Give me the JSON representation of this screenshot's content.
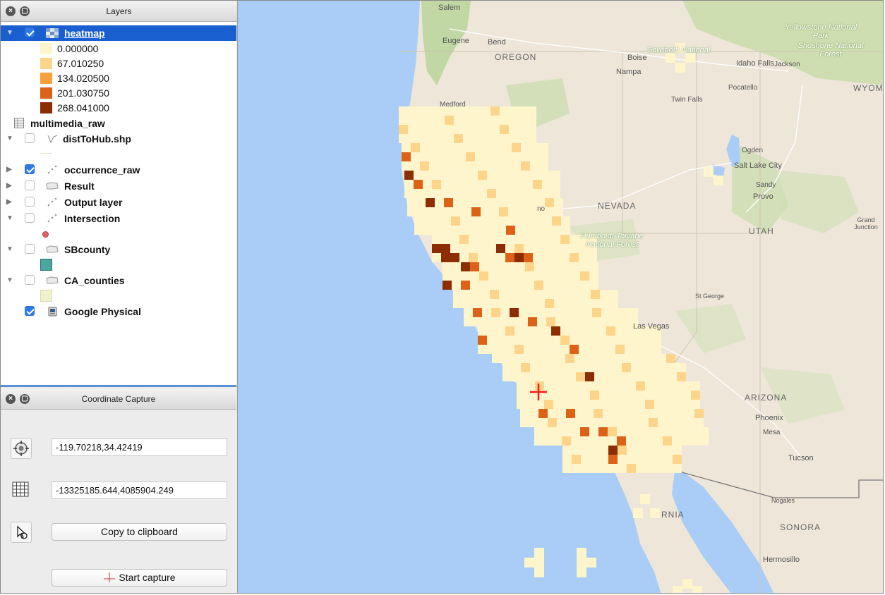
{
  "layers_panel": {
    "title": "Layers",
    "layers": [
      {
        "name": "heatmap",
        "checked": true,
        "expanded": true,
        "selected": true,
        "icon": "raster-heatmap-icon"
      },
      {
        "name": "multimedia_raw",
        "checked": null,
        "icon": "table-icon"
      },
      {
        "name": "distToHub.shp",
        "checked": false,
        "expanded": true,
        "icon": "line-layer-icon"
      },
      {
        "name": "occurrence_raw",
        "checked": true,
        "expanded": false,
        "icon": "point-layer-icon"
      },
      {
        "name": "Result",
        "checked": false,
        "expanded": false,
        "icon": "polygon-layer-icon"
      },
      {
        "name": "Output layer",
        "checked": false,
        "expanded": false,
        "icon": "point-layer-icon"
      },
      {
        "name": "Intersection",
        "checked": false,
        "expanded": true,
        "icon": "point-layer-icon"
      },
      {
        "name": "SBcounty",
        "checked": false,
        "expanded": true,
        "icon": "polygon-layer-icon"
      },
      {
        "name": "CA_counties",
        "checked": false,
        "expanded": true,
        "icon": "polygon-layer-icon"
      },
      {
        "name": "Google Physical",
        "checked": true,
        "icon": "wms-raster-icon"
      }
    ],
    "heatmap_legend": [
      {
        "label": "0.000000",
        "color": "#fff5cc"
      },
      {
        "label": "67.010250",
        "color": "#fdd58a"
      },
      {
        "label": "134.020500",
        "color": "#f9a03a"
      },
      {
        "label": "201.030750",
        "color": "#dc6218"
      },
      {
        "label": "268.041000",
        "color": "#8c2d04"
      }
    ],
    "symbols": {
      "intersection_color": "#e06666",
      "sbcounty_color": "#4aa6a0",
      "ca_counties_color": "#f0f2cc"
    }
  },
  "coordinate_capture": {
    "title": "Coordinate Capture",
    "geographic_value": "-119.70218,34.42419",
    "projected_value": "-13325185.644,4085904.249",
    "copy_button_label": "Copy to clipboard",
    "start_button_label": "Start capture"
  },
  "map": {
    "labels": {
      "salem": "Salem",
      "eugene": "Eugene",
      "bend": "Bend",
      "oregon": "OREGON",
      "boise": "Boise",
      "nampa": "Nampa",
      "sawtooth": "Sawtooth National",
      "idaho_falls": "Idaho Falls",
      "jackson": "Jackson",
      "yellowstone": "Yellowstone National Park",
      "shoshone": "Shoshone National Forest",
      "pocatello": "Pocatello",
      "wyoming": "WYOM",
      "twin_falls": "Twin Falls",
      "medford": "Medford",
      "ogden": "Ogden",
      "salt_lake": "Salt Lake City",
      "sandy": "Sandy",
      "provo": "Provo",
      "nevada": "NEVADA",
      "humboldt": "Humboldt-Toiyabe National Forest",
      "utah": "UTAH",
      "grand_junction": "Grand Junction",
      "st_george": "St George",
      "las_vegas": "Las Vegas",
      "arizona": "ARIZONA",
      "phoenix": "Phoenix",
      "mesa": "Mesa",
      "tucson": "Tucson",
      "nogales": "Nogales",
      "sonora": "SONORA",
      "hermosillo": "Hermosillo",
      "california_partial": "RNIA",
      "reno_partial": "no"
    },
    "capture_marker_color": "#ff1a1a"
  }
}
